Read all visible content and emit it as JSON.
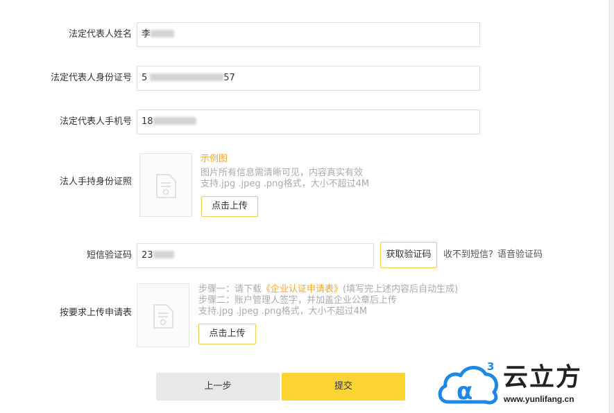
{
  "form": {
    "legal_name": {
      "label": "法定代表人姓名",
      "value_prefix": "李"
    },
    "legal_id": {
      "label": "法定代表人身份证号",
      "value_prefix": "5",
      "value_suffix": "57"
    },
    "legal_phone": {
      "label": "法定代表人手机号",
      "value_prefix": "18"
    },
    "id_photo": {
      "label": "法人手持身份证照",
      "example_link": "示例图",
      "hint_1": "图片所有信息需清晰可见，内容真实有效",
      "hint_2": "支持.jpg .jpeg .png格式，大小不超过4M",
      "upload_label": "点击上传"
    },
    "sms": {
      "label": "短信验证码",
      "value_prefix": "23",
      "get_code_label": "获取验证码",
      "no_sms_text": "收不到短信?",
      "voice_code_link": "语音验证码"
    },
    "application": {
      "label": "按要求上传申请表",
      "step1_prefix": "步骤一：请下载",
      "step1_link": "《企业认证申请表》",
      "step1_suffix": "(填写完上述内容后自动生成)",
      "step2": "步骤二：账户管理人签字，并加盖企业公章后上传",
      "hint": "支持.jpg .jpeg .png格式，大小不超过4M",
      "upload_label": "点击上传"
    }
  },
  "actions": {
    "prev_label": "上一步",
    "submit_label": "提交"
  },
  "watermark": {
    "title": "云立方",
    "url": "www.yunlifang.cn",
    "superscript": "3"
  },
  "colors": {
    "accent": "#f5a623",
    "submit_bg": "#fcd535",
    "outline": "#f2c94c"
  }
}
